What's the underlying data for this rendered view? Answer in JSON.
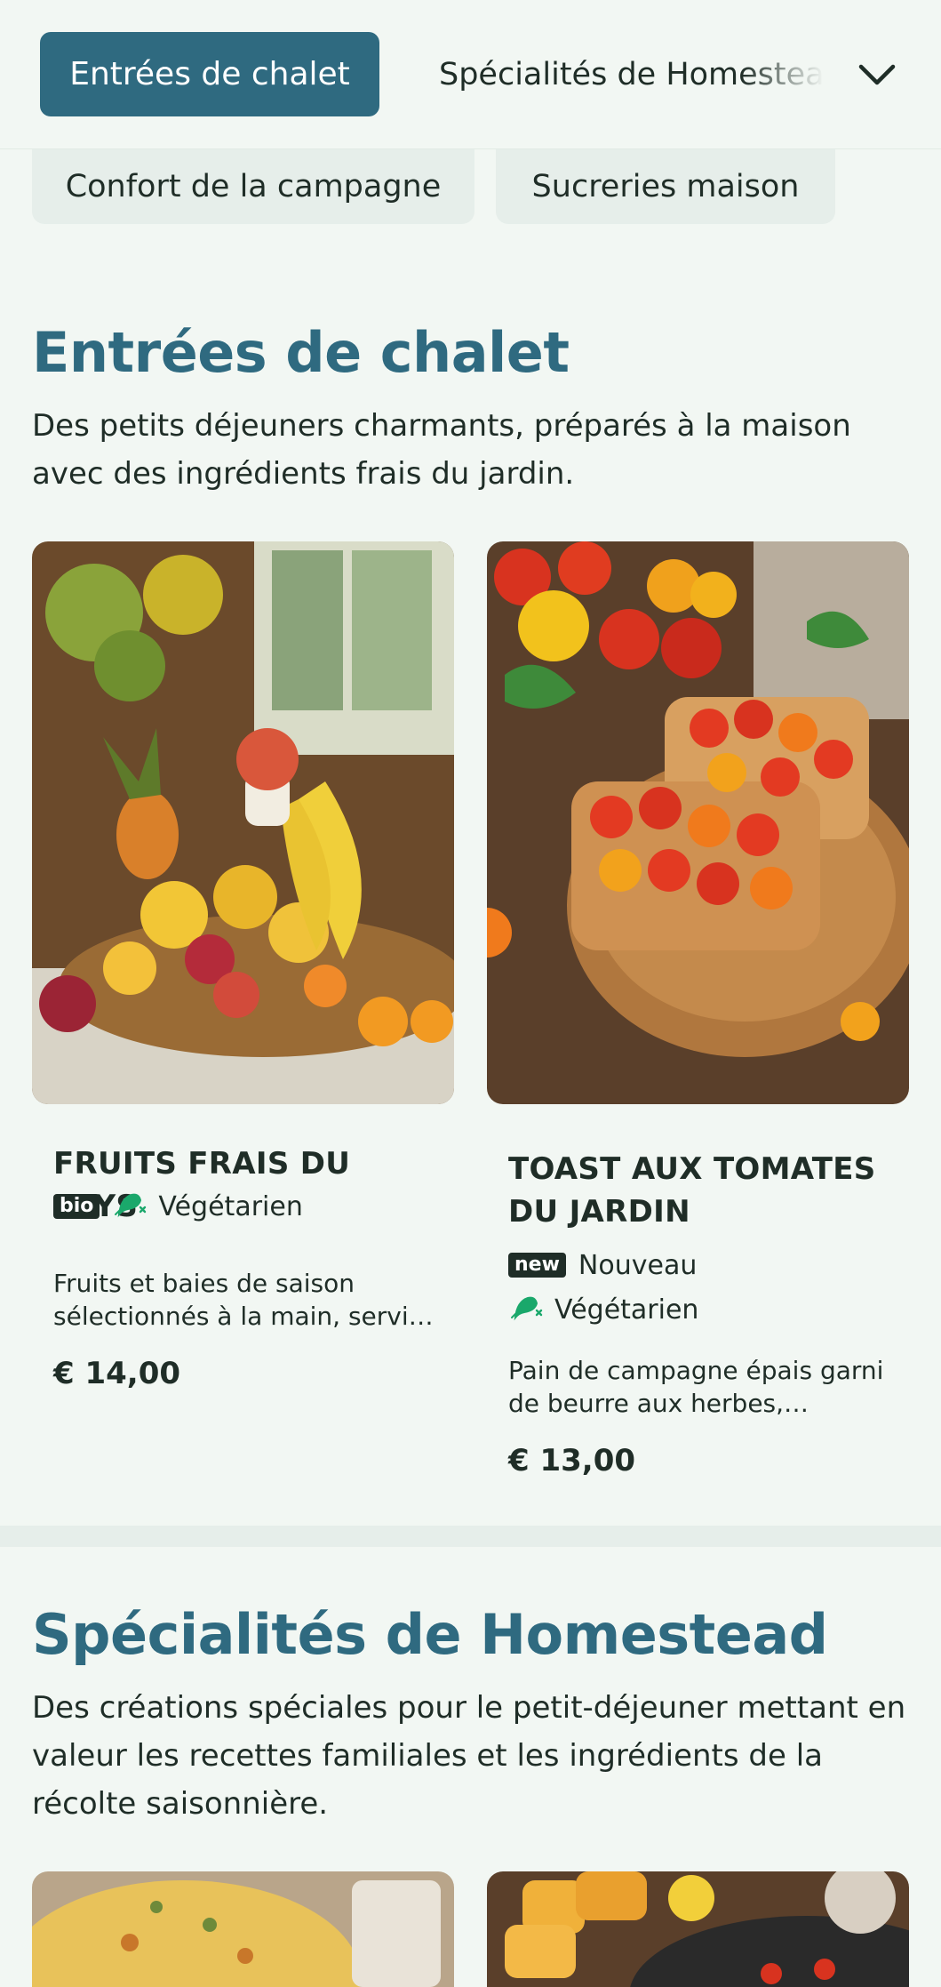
{
  "nav": {
    "active": "Entrées de chalet",
    "next": "Spécialités de Homestead",
    "row2": [
      "Confort de la campagne",
      "Sucreries maison"
    ],
    "expand_icon": "chevron-down-icon"
  },
  "sections": [
    {
      "title": "Entrées de chalet",
      "description": "Des petits déjeuners charmants, préparés à la maison avec des ingrédients frais du jardin.",
      "items": [
        {
          "name": "FRUITS FRAIS DU PAYS",
          "badge": "bio",
          "diet": "Végétarien",
          "description": "Fruits et baies de saison sélectionnés à la main, servis avec du yaourt et du miel local.",
          "price": "€ 14,00",
          "image": "fruit-basket-photo"
        },
        {
          "name": "TOAST AUX TOMATES DU JARDIN",
          "badge": "new",
          "badge_label": "Nouveau",
          "diet": "Végétarien",
          "description": "Pain de campagne épais garni de beurre aux herbes, tomates du jardin et basilic frais.",
          "price": "€ 13,00",
          "image": "tomato-toast-photo"
        }
      ]
    },
    {
      "title": "Spécialités de Homestead",
      "description": "Des créations spéciales pour le petit-déjeuner mettant en valeur les recettes familiales et les ingrédients de la récolte saisonnière.",
      "items": [
        {
          "image": "quiche-photo"
        },
        {
          "image": "skillet-potatoes-photo"
        }
      ]
    }
  ],
  "colors": {
    "accent": "#2f6a80",
    "background": "#f2f7f3",
    "text": "#1f2d27",
    "veg_green": "#1aa86b"
  }
}
